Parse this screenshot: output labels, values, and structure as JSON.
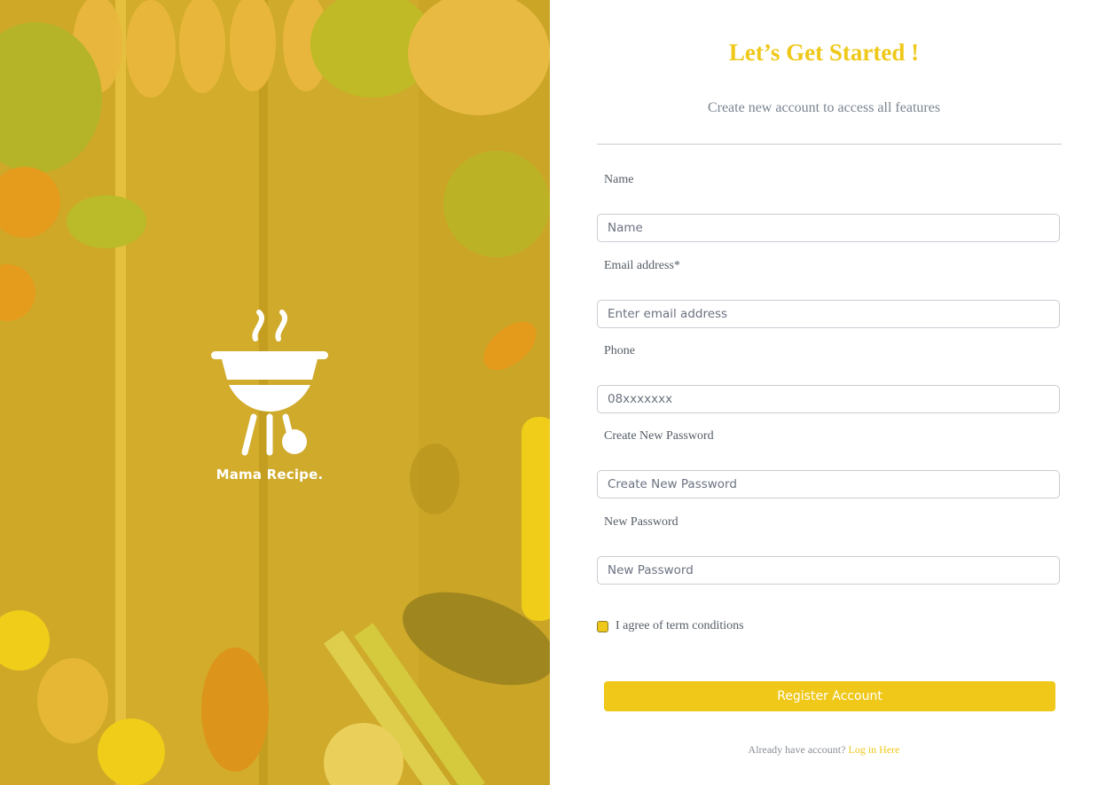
{
  "brand": {
    "name": "Mama Recipe.",
    "logo_icon": "grill-icon",
    "background_image": "wooden-table-with-vegetables-and-seafood",
    "overlay_color": "#efc81a"
  },
  "header": {
    "title": "Let’s Get Started !",
    "subtitle": "Create new account to access all features"
  },
  "form": {
    "name": {
      "label": "Name",
      "placeholder": "Name"
    },
    "email": {
      "label": "Email address*",
      "placeholder": "Enter email address"
    },
    "phone": {
      "label": "Phone",
      "placeholder": "08xxxxxxx"
    },
    "create_password": {
      "label": "Create New Password",
      "placeholder": "Create New Password"
    },
    "new_password": {
      "label": "New Password",
      "placeholder": "New Password"
    },
    "agree_label": "I agree of term conditions",
    "agree_checked": true,
    "submit_label": "Register Account"
  },
  "footer": {
    "prompt": "Already have account?",
    "link_label": "Log in Here"
  },
  "colors": {
    "accent": "#efc81a",
    "muted_text": "#7a8491",
    "border": "#c8ccd2"
  }
}
